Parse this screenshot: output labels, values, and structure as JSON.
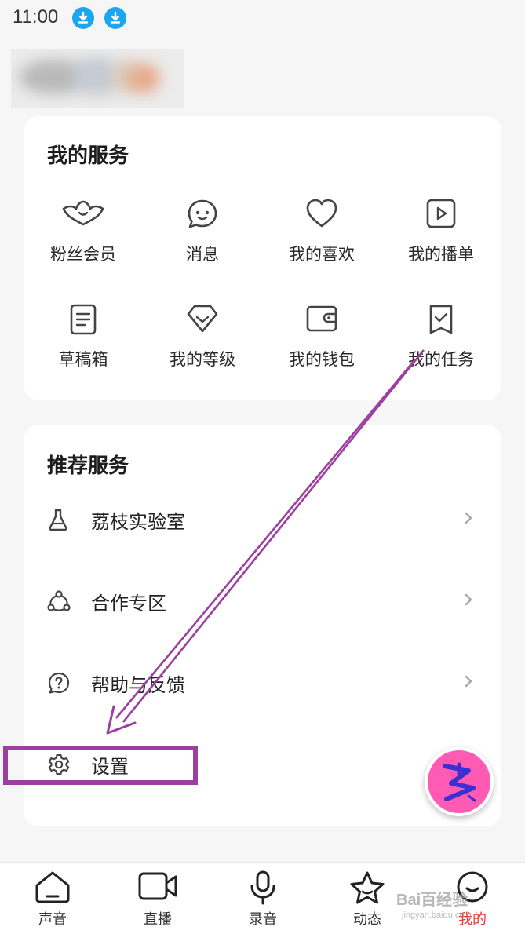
{
  "status_bar": {
    "time": "11:00",
    "icons": [
      "download-badge-icon",
      "download-badge-icon"
    ]
  },
  "my_services": {
    "title": "我的服务",
    "items": [
      {
        "label": "粉丝会员",
        "icon": "fan-member-icon"
      },
      {
        "label": "消息",
        "icon": "message-icon"
      },
      {
        "label": "我的喜欢",
        "icon": "heart-icon"
      },
      {
        "label": "我的播单",
        "icon": "playlist-icon"
      },
      {
        "label": "草稿箱",
        "icon": "draft-icon"
      },
      {
        "label": "我的等级",
        "icon": "level-icon"
      },
      {
        "label": "我的钱包",
        "icon": "wallet-icon"
      },
      {
        "label": "我的任务",
        "icon": "task-icon"
      }
    ]
  },
  "recommended_services": {
    "title": "推荐服务",
    "items": [
      {
        "label": "荔枝实验室",
        "icon": "flask-icon"
      },
      {
        "label": "合作专区",
        "icon": "cooperation-icon"
      },
      {
        "label": "帮助与反馈",
        "icon": "help-icon"
      },
      {
        "label": "设置",
        "icon": "gear-icon"
      }
    ]
  },
  "bottom_nav": {
    "items": [
      {
        "label": "声音",
        "icon": "home-icon",
        "active": false
      },
      {
        "label": "直播",
        "icon": "video-camera-icon",
        "active": false
      },
      {
        "label": "录音",
        "icon": "microphone-icon",
        "active": false
      },
      {
        "label": "动态",
        "icon": "star-icon",
        "active": false
      },
      {
        "label": "我的",
        "icon": "profile-icon",
        "active": true
      }
    ]
  },
  "watermark": {
    "brand": "Bai百经验",
    "url": "jingyan.baidu.com"
  },
  "colors": {
    "background": "#f6f6f6",
    "card": "#ffffff",
    "annotation_purple": "#9b3fa0",
    "active_nav": "#e53935",
    "fab_pink": "#ff5bb4",
    "badge_blue": "#1aa7f0"
  }
}
